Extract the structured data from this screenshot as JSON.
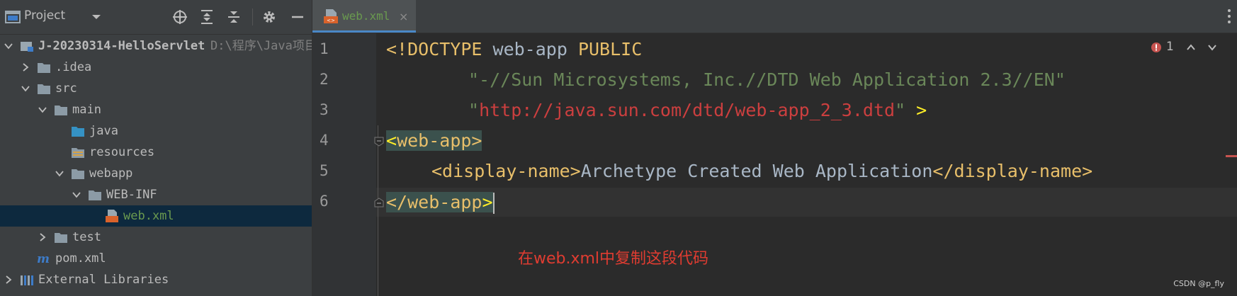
{
  "project_panel": {
    "title": "Project",
    "tree": [
      {
        "label": "J-20230314-HelloServlet",
        "path": "D:\\程序\\Java项目",
        "icon": "module-icon",
        "arrow": "down",
        "indent": 0,
        "bold": true
      },
      {
        "label": ".idea",
        "icon": "folder-icon",
        "arrow": "right",
        "indent": 1
      },
      {
        "label": "src",
        "icon": "folder-icon",
        "arrow": "down",
        "indent": 1
      },
      {
        "label": "main",
        "icon": "folder-icon",
        "arrow": "down",
        "indent": 2
      },
      {
        "label": "java",
        "icon": "source-folder-icon",
        "arrow": "none",
        "indent": 3
      },
      {
        "label": "resources",
        "icon": "resources-folder-icon",
        "arrow": "none",
        "indent": 3
      },
      {
        "label": "webapp",
        "icon": "folder-icon",
        "arrow": "down",
        "indent": 3
      },
      {
        "label": "WEB-INF",
        "icon": "folder-icon",
        "arrow": "down",
        "indent": 4
      },
      {
        "label": "web.xml",
        "icon": "xml-file-icon",
        "arrow": "none",
        "indent": 5,
        "selected": true
      },
      {
        "label": "test",
        "icon": "folder-icon",
        "arrow": "right",
        "indent": 2
      },
      {
        "label": "pom.xml",
        "icon": "maven-icon",
        "arrow": "none",
        "indent": 1
      },
      {
        "label": "External Libraries",
        "icon": "libraries-icon",
        "arrow": "right",
        "indent": 0
      }
    ]
  },
  "editor": {
    "tab_label": "web.xml",
    "tab_close": "×",
    "error_count": "1",
    "line_numbers": [
      "1",
      "2",
      "3",
      "4",
      "5",
      "6"
    ],
    "code": {
      "l1_a": "<!DOCTYPE ",
      "l1_b": "web-app ",
      "l1_c": "PUBLIC",
      "l2": "\"-//Sun Microsystems, Inc.//DTD Web Application 2.3//EN\"",
      "l3_q1": "\"",
      "l3_url": "http://java.sun.com/dtd/web-app_2_3.dtd",
      "l3_q2": "\"",
      "l3_end": " >",
      "l4_lt": "<",
      "l4_name": "web-app",
      "l4_gt": ">",
      "l5_open": "<display-name>",
      "l5_text": "Archetype Created Web Application",
      "l5_close": "</display-name>",
      "l6_lt": "</",
      "l6_name": "web-app",
      "l6_gt": ">"
    }
  },
  "annotation": "在web.xml中复制这段代码",
  "watermark": "CSDN @p_fly",
  "colors": {
    "background": "#2b2b2b",
    "panel": "#3c3f41",
    "tag": "#e8bf6a",
    "string": "#6a8759",
    "url": "#cc3f3f",
    "annotation": "#e03c31"
  }
}
